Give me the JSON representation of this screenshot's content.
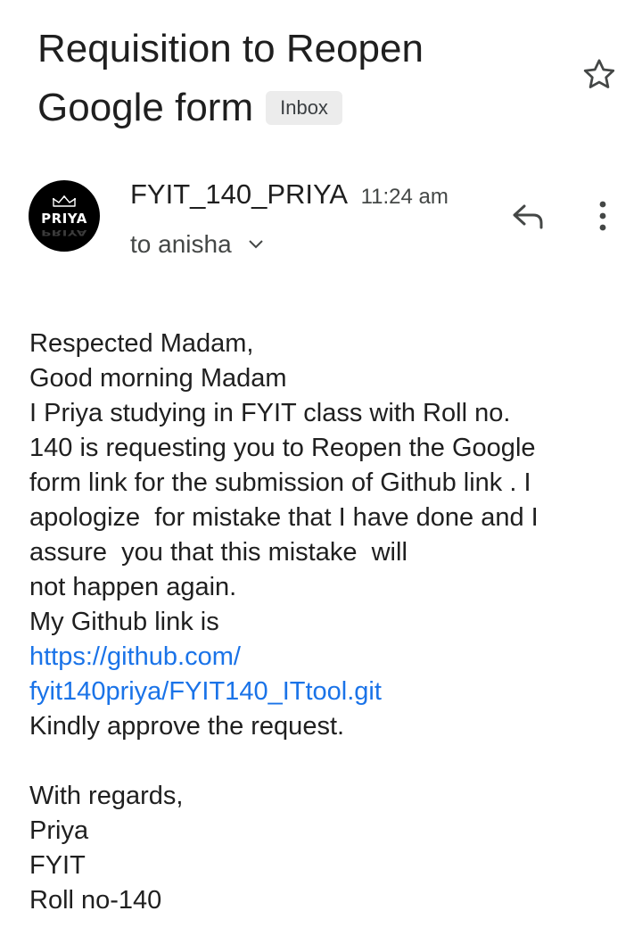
{
  "email": {
    "subject_line1": "Requisition to Reopen",
    "subject_line2": "Google form",
    "label": "Inbox",
    "sender": {
      "avatar_text": "PRIYA",
      "name": "FYIT_140_PRIYA",
      "time": "11:24 am",
      "to": "to anisha"
    },
    "icons": {
      "star": "star-outline-icon",
      "reply": "reply-icon",
      "more": "more-vertical-icon",
      "expand": "chevron-down-icon",
      "crown": "crown-icon"
    },
    "body": {
      "greeting": "Respected Madam,",
      "line2": "Good morning Madam",
      "line3": "I Priya studying in FYIT class with Roll no.",
      "line4": "140 is requesting you to Reopen the Google",
      "line5": "form link for the submission of Github link . I",
      "line6": "apologize  for mistake that I have done and I",
      "line7": "assure  you that this mistake  will",
      "line8": "not happen again.",
      "line9": "My Github link is",
      "link_line1": "https://github.com/",
      "link_line2": "fyit140priya/FYIT140_ITtool.git",
      "line12": "Kindly approve the request.",
      "closing": "With regards,",
      "sign_name": "Priya",
      "sign_class": "FYIT",
      "sign_roll": "Roll no-140"
    },
    "colors": {
      "link": "#1a73e8",
      "badge_bg": "#ececec"
    }
  }
}
